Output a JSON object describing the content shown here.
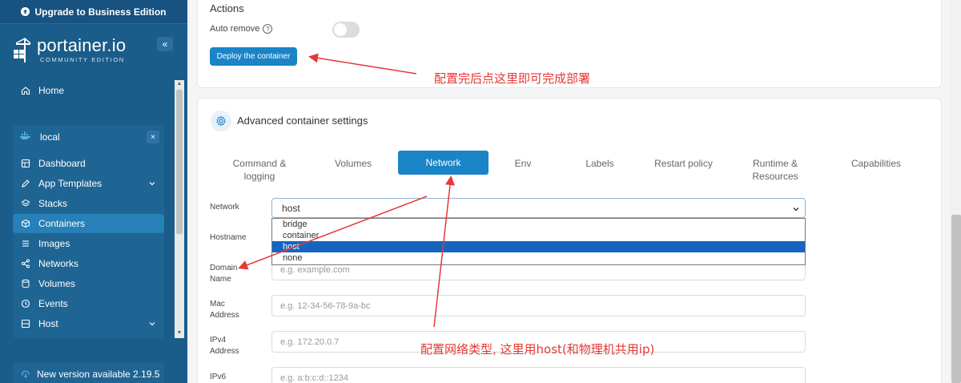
{
  "sidebar": {
    "upgrade_label": "Upgrade to Business Edition",
    "logo_name": "portainer.io",
    "logo_edition": "COMMUNITY EDITION",
    "collapse_label": "«",
    "home_label": "Home",
    "environment": {
      "name": "local",
      "close_label": "×"
    },
    "items": [
      {
        "label": "Dashboard",
        "icon": "dashboard-icon"
      },
      {
        "label": "App Templates",
        "icon": "edit-icon",
        "expandable": true
      },
      {
        "label": "Stacks",
        "icon": "stacks-icon"
      },
      {
        "label": "Containers",
        "icon": "cube-icon",
        "active": true
      },
      {
        "label": "Images",
        "icon": "list-icon"
      },
      {
        "label": "Networks",
        "icon": "share-icon"
      },
      {
        "label": "Volumes",
        "icon": "database-icon"
      },
      {
        "label": "Events",
        "icon": "clock-icon"
      },
      {
        "label": "Host",
        "icon": "server-icon",
        "expandable": true
      }
    ],
    "new_version_label": "New version available 2.19.5"
  },
  "actions": {
    "title": "Actions",
    "auto_remove_label": "Auto remove",
    "auto_remove_on": false,
    "deploy_label": "Deploy the container"
  },
  "advanced": {
    "title": "Advanced container settings",
    "tabs": [
      {
        "label": "Command & logging"
      },
      {
        "label": "Volumes"
      },
      {
        "label": "Network",
        "active": true
      },
      {
        "label": "Env"
      },
      {
        "label": "Labels"
      },
      {
        "label": "Restart policy"
      },
      {
        "label": "Runtime & Resources"
      },
      {
        "label": "Capabilities"
      }
    ],
    "network": {
      "label": "Network",
      "selected": "host",
      "options": [
        "bridge",
        "container",
        "host",
        "none"
      ]
    },
    "fields": {
      "hostname_label": "Hostname",
      "domain_label": "Domain Name",
      "domain_placeholder": "e.g. example.com",
      "mac_label": "Mac Address",
      "mac_placeholder": "e.g. 12-34-56-78-9a-bc",
      "ipv4_label": "IPv4 Address",
      "ipv4_placeholder": "e.g. 172.20.0.7",
      "ipv6_label": "IPv6",
      "ipv6_placeholder": "e.g. a:b:c:d::1234"
    }
  },
  "annotations": {
    "deploy_note": "配置完后点这里即可完成部署",
    "network_note": "配置网络类型, 这里用host(和物理机共用ip)"
  },
  "colors": {
    "sidebar_bg": "#1a5c8a",
    "accent": "#1a84c6",
    "annotation": "#e53935"
  }
}
